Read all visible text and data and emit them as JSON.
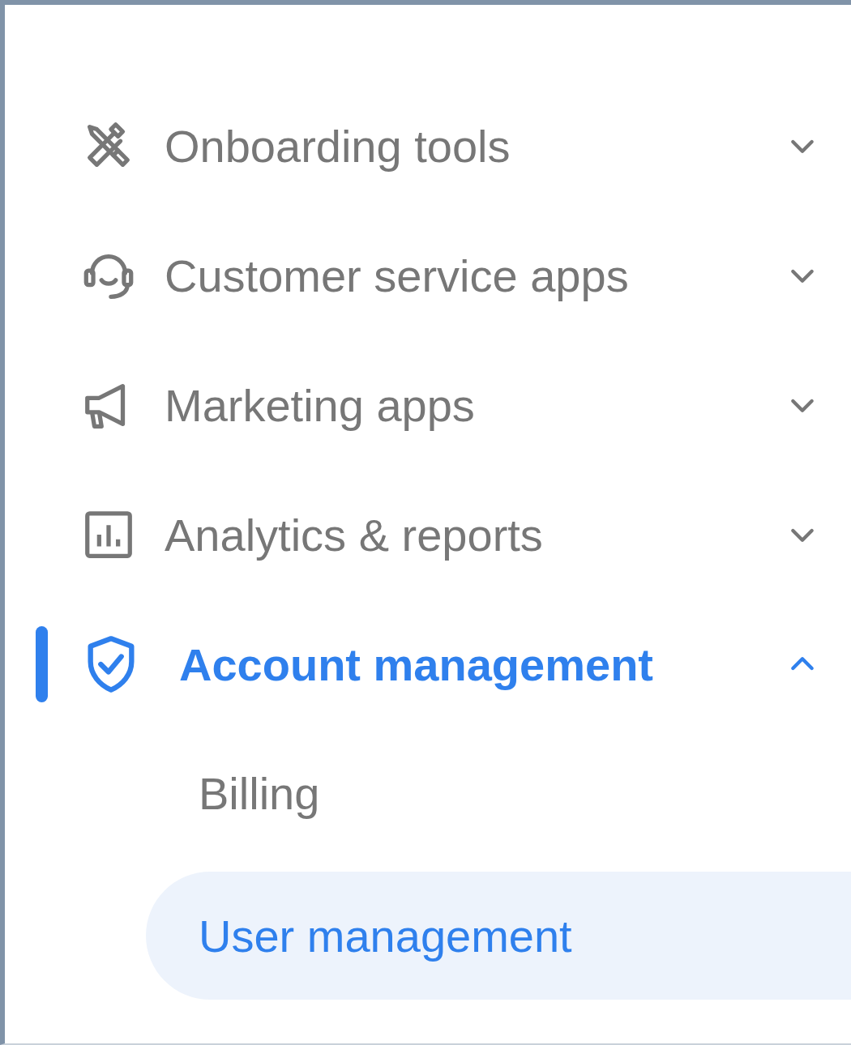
{
  "nav": {
    "items": [
      {
        "label": "Onboarding tools",
        "expanded": false,
        "selected": false
      },
      {
        "label": "Customer service apps",
        "expanded": false,
        "selected": false
      },
      {
        "label": "Marketing apps",
        "expanded": false,
        "selected": false
      },
      {
        "label": "Analytics & reports",
        "expanded": false,
        "selected": false
      },
      {
        "label": "Account management",
        "expanded": true,
        "selected": true,
        "children": [
          {
            "label": "Billing",
            "selected": false
          },
          {
            "label": "User management",
            "selected": true
          }
        ]
      }
    ]
  }
}
